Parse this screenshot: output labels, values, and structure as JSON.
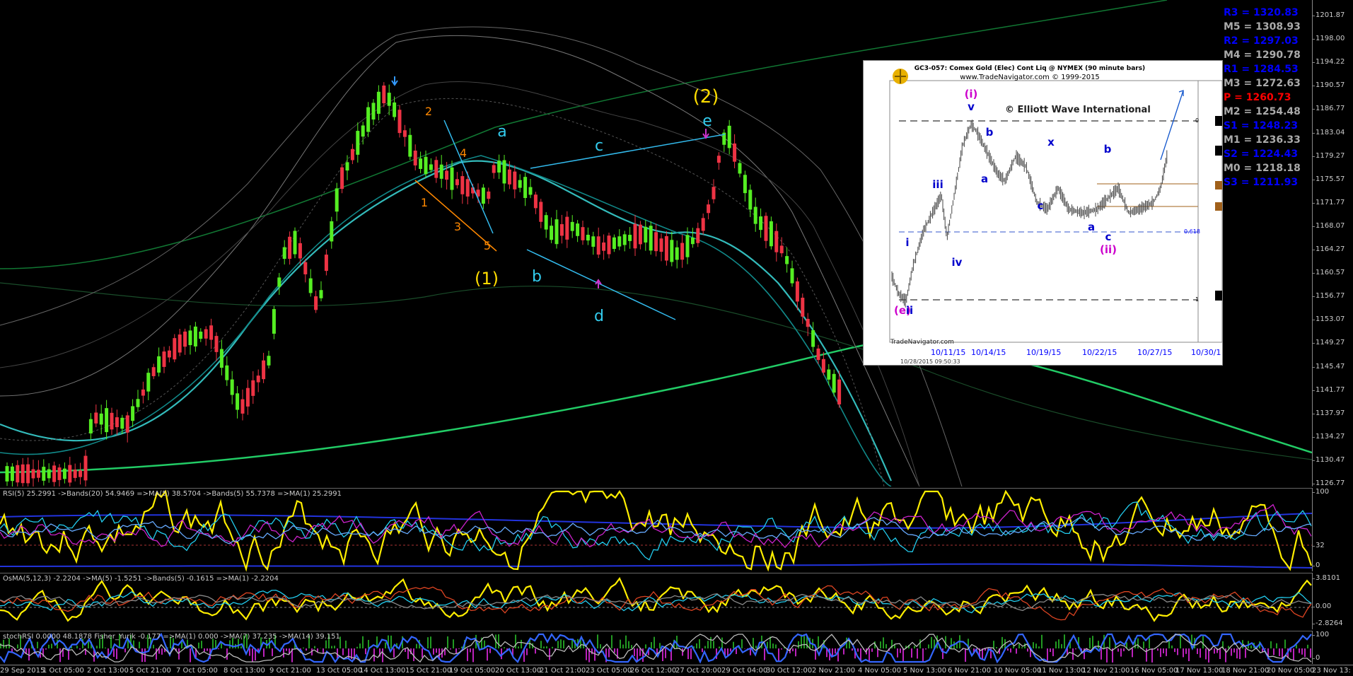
{
  "main": {
    "price_ticks": [
      "1201.87",
      "1198.00",
      "1194.22",
      "1190.57",
      "1186.77",
      "1183.04",
      "1179.27",
      "1175.57",
      "1171.77",
      "1168.07",
      "1164.27",
      "1160.57",
      "1156.77",
      "1153.07",
      "1149.27",
      "1145.47",
      "1141.77",
      "1137.97",
      "1134.27",
      "1130.47",
      "1126.77"
    ],
    "wave_labels": [
      {
        "text": "(2)",
        "color": "#ffdd00"
      },
      {
        "text": "e",
        "color": "#33ccee"
      },
      {
        "text": "a",
        "color": "#33ccee"
      },
      {
        "text": "c",
        "color": "#33ccee"
      },
      {
        "text": "b",
        "color": "#33ccee"
      },
      {
        "text": "d",
        "color": "#33ccee"
      },
      {
        "text": "(1)",
        "color": "#ffdd00"
      },
      {
        "text": "2",
        "color": "#ff8800"
      },
      {
        "text": "4",
        "color": "#ff8800"
      },
      {
        "text": "1",
        "color": "#ff8800"
      },
      {
        "text": "3",
        "color": "#ff8800"
      },
      {
        "text": "5",
        "color": "#ff8800"
      }
    ],
    "pivots": [
      {
        "label": "R3 = 1320.83",
        "color": "#0000ff"
      },
      {
        "label": "M5 = 1308.93",
        "color": "#aaaaaa"
      },
      {
        "label": "R2 = 1297.03",
        "color": "#0000ff"
      },
      {
        "label": "M4 = 1290.78",
        "color": "#aaaaaa"
      },
      {
        "label": "R1 = 1284.53",
        "color": "#0000ff"
      },
      {
        "label": "M3 = 1272.63",
        "color": "#aaaaaa"
      },
      {
        "label": "P  = 1260.73",
        "color": "#ff0000"
      },
      {
        "label": "M2 = 1254.48",
        "color": "#aaaaaa"
      },
      {
        "label": "S1 = 1248.23",
        "color": "#0000ff"
      },
      {
        "label": "M1 = 1236.33",
        "color": "#aaaaaa"
      },
      {
        "label": "S2 = 1224.43",
        "color": "#0000ff"
      },
      {
        "label": "M0 = 1218.18",
        "color": "#aaaaaa"
      },
      {
        "label": "S3 = 1211.93",
        "color": "#0000ff"
      }
    ]
  },
  "inset": {
    "title": "GC3-057:  Comex Gold (Elec) Cont Liq @ NYMEX  (90 minute bars)",
    "subtitle": "www.TradeNavigator.com © 1999-2015",
    "copyright": "© Elliott Wave International",
    "footer": "TradeNavigator.com",
    "stamp": "10/28/2015  09:50:33",
    "dates": [
      "10/11/15",
      "10/14/15",
      "10/19/15",
      "10/22/15",
      "10/27/15",
      "10/30/1"
    ],
    "fib_label": "0.618",
    "level_labels": [
      "0",
      "1"
    ],
    "wave_labels": [
      {
        "text": "(i)",
        "color": "#cc00cc"
      },
      {
        "text": "v",
        "color": "#0000cc"
      },
      {
        "text": "b",
        "color": "#0000cc"
      },
      {
        "text": "x",
        "color": "#0000cc"
      },
      {
        "text": "b",
        "color": "#0000cc"
      },
      {
        "text": "iii",
        "color": "#0000cc"
      },
      {
        "text": "a",
        "color": "#0000cc"
      },
      {
        "text": "c",
        "color": "#0000cc"
      },
      {
        "text": "a",
        "color": "#0000cc"
      },
      {
        "text": "c",
        "color": "#0000cc"
      },
      {
        "text": "(ii)",
        "color": "#cc00cc"
      },
      {
        "text": "i",
        "color": "#0000cc"
      },
      {
        "text": "iv",
        "color": "#0000cc"
      },
      {
        "text": "(e)",
        "color": "#cc00cc"
      },
      {
        "text": "ii",
        "color": "#0000cc"
      }
    ]
  },
  "rsi": {
    "label": "RSI(5) 25.2991  ->Bands(20) 54.9469  =>MA(5) 38.5704  ->Bands(5) 55.7378  =>MA(1) 25.2991",
    "ticks": [
      "100",
      "32",
      "0"
    ]
  },
  "osma": {
    "label": "OsMA(5,12,3) -2.2204  ->MA(5) -1.5251  ->Bands(5) -0.1615  =>MA(1) -2.2204",
    "ticks": [
      "3.8101",
      "0.00",
      "-2.8264"
    ]
  },
  "stoch": {
    "label": "stochRSI 0.0000 48.1878  Fisher_Yurik -0.177  =>MA(1) 0.000  ->MA(7) 37.235  ->MA(14) 39.151",
    "ticks": [
      "100",
      "0"
    ]
  },
  "time_axis": [
    "29 Sep 2015",
    "1 Oct 05:00",
    "2 Oct 13:00",
    "5 Oct 21:00",
    "7 Oct 05:00",
    "8 Oct 13:00",
    "9 Oct 21:00",
    "13 Oct 05:00",
    "14 Oct 13:00",
    "15 Oct 21:00",
    "19 Oct 05:00",
    "20 Oct 13:00",
    "21 Oct 21:00",
    "23 Oct 05:00",
    "26 Oct 12:00",
    "27 Oct 20:00",
    "29 Oct 04:00",
    "30 Oct 12:00",
    "2 Nov 21:00",
    "4 Nov 05:00",
    "5 Nov 13:00",
    "6 Nov 21:00",
    "10 Nov 05:00",
    "11 Nov 13:00",
    "12 Nov 21:00",
    "16 Nov 05:00",
    "17 Nov 13:00",
    "18 Nov 21:00",
    "20 Nov 05:00",
    "23 Nov 13:"
  ]
}
